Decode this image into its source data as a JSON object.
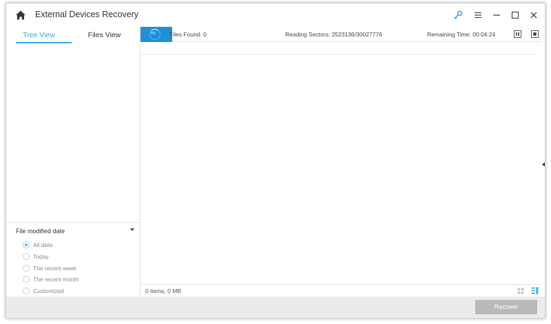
{
  "app": {
    "title": "External Devices Recovery"
  },
  "titlebar": {
    "icons": [
      "home-icon",
      "key-icon",
      "menu-icon",
      "minimize-icon",
      "maximize-icon",
      "close-icon"
    ],
    "accent": "#3aa3e3"
  },
  "tabs": [
    {
      "label": "Tree View",
      "active": true
    },
    {
      "label": "Files View",
      "active": false
    }
  ],
  "filter": {
    "title": "File modified date",
    "options": [
      {
        "label": "All data",
        "checked": true
      },
      {
        "label": "Today",
        "checked": false
      },
      {
        "label": "The recent week",
        "checked": false
      },
      {
        "label": "The recent month",
        "checked": false
      },
      {
        "label": "Customized",
        "checked": false
      }
    ]
  },
  "scan": {
    "files_found": "Files Found:  0",
    "reading_sectors": "Reading Sectors:  2523136/30027776",
    "remaining_time": "Remaining Time: 00:04:24",
    "progress_color": "#1f8fd6",
    "progress_text": "8%"
  },
  "footer": {
    "item_count": "0 items, 0 MB"
  },
  "actions": {
    "recover_label": "Recover",
    "recover_color": "#b9b9b9"
  }
}
